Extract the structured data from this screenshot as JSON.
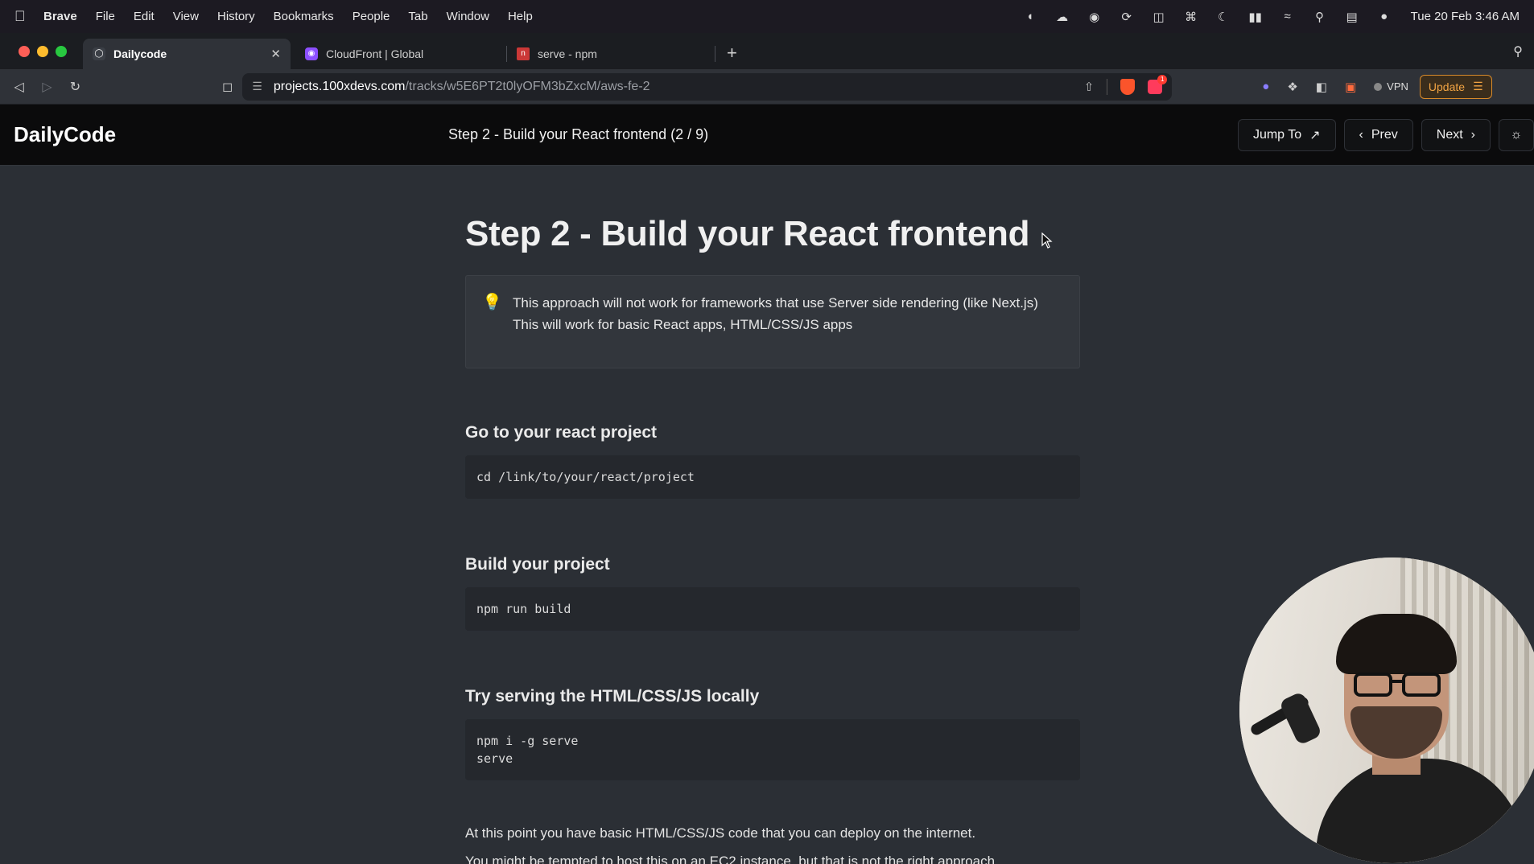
{
  "menubar": {
    "app": "Brave",
    "items": [
      "File",
      "Edit",
      "View",
      "History",
      "Bookmarks",
      "People",
      "Tab",
      "Window",
      "Help"
    ],
    "clock": "Tue 20 Feb  3:46 AM"
  },
  "tabs": [
    {
      "title": "Dailycode",
      "active": true
    },
    {
      "title": "CloudFront | Global",
      "active": false
    },
    {
      "title": "serve - npm",
      "active": false
    }
  ],
  "address": {
    "host": "projects.100xdevs.com",
    "path": "/tracks/w5E6PT2t0lyOFM3bZxcM/aws-fe-2",
    "shield_badge": "1"
  },
  "browser_actions": {
    "vpn_label": "VPN",
    "update_label": "Update"
  },
  "site": {
    "logo": "DailyCode",
    "header_title": "Step 2 - Build your React frontend (2 / 9)",
    "jump_to": "Jump To",
    "prev": "Prev",
    "next": "Next"
  },
  "article": {
    "title": "Step 2 - Build your React frontend",
    "callout_line1": "This approach will not work for frameworks that use Server side rendering (like Next.js)",
    "callout_line2": "This will work for basic React apps, HTML/CSS/JS apps",
    "sections": [
      {
        "heading": "Go to your react project",
        "code": "cd /link/to/your/react/project"
      },
      {
        "heading": "Build your project",
        "code": "npm run build"
      },
      {
        "heading": "Try serving the HTML/CSS/JS locally",
        "code": "npm i -g serve\nserve"
      }
    ],
    "para1": "At this point you have basic HTML/CSS/JS code that you can deploy on the internet.",
    "para2": "You might be tempted to host this on an EC2 instance, but that is not the right approach"
  },
  "colors": {
    "page_bg": "#2b2f35",
    "header_bg": "#0b0b0c",
    "code_bg": "#25282d",
    "update_accent": "#f2a443"
  }
}
